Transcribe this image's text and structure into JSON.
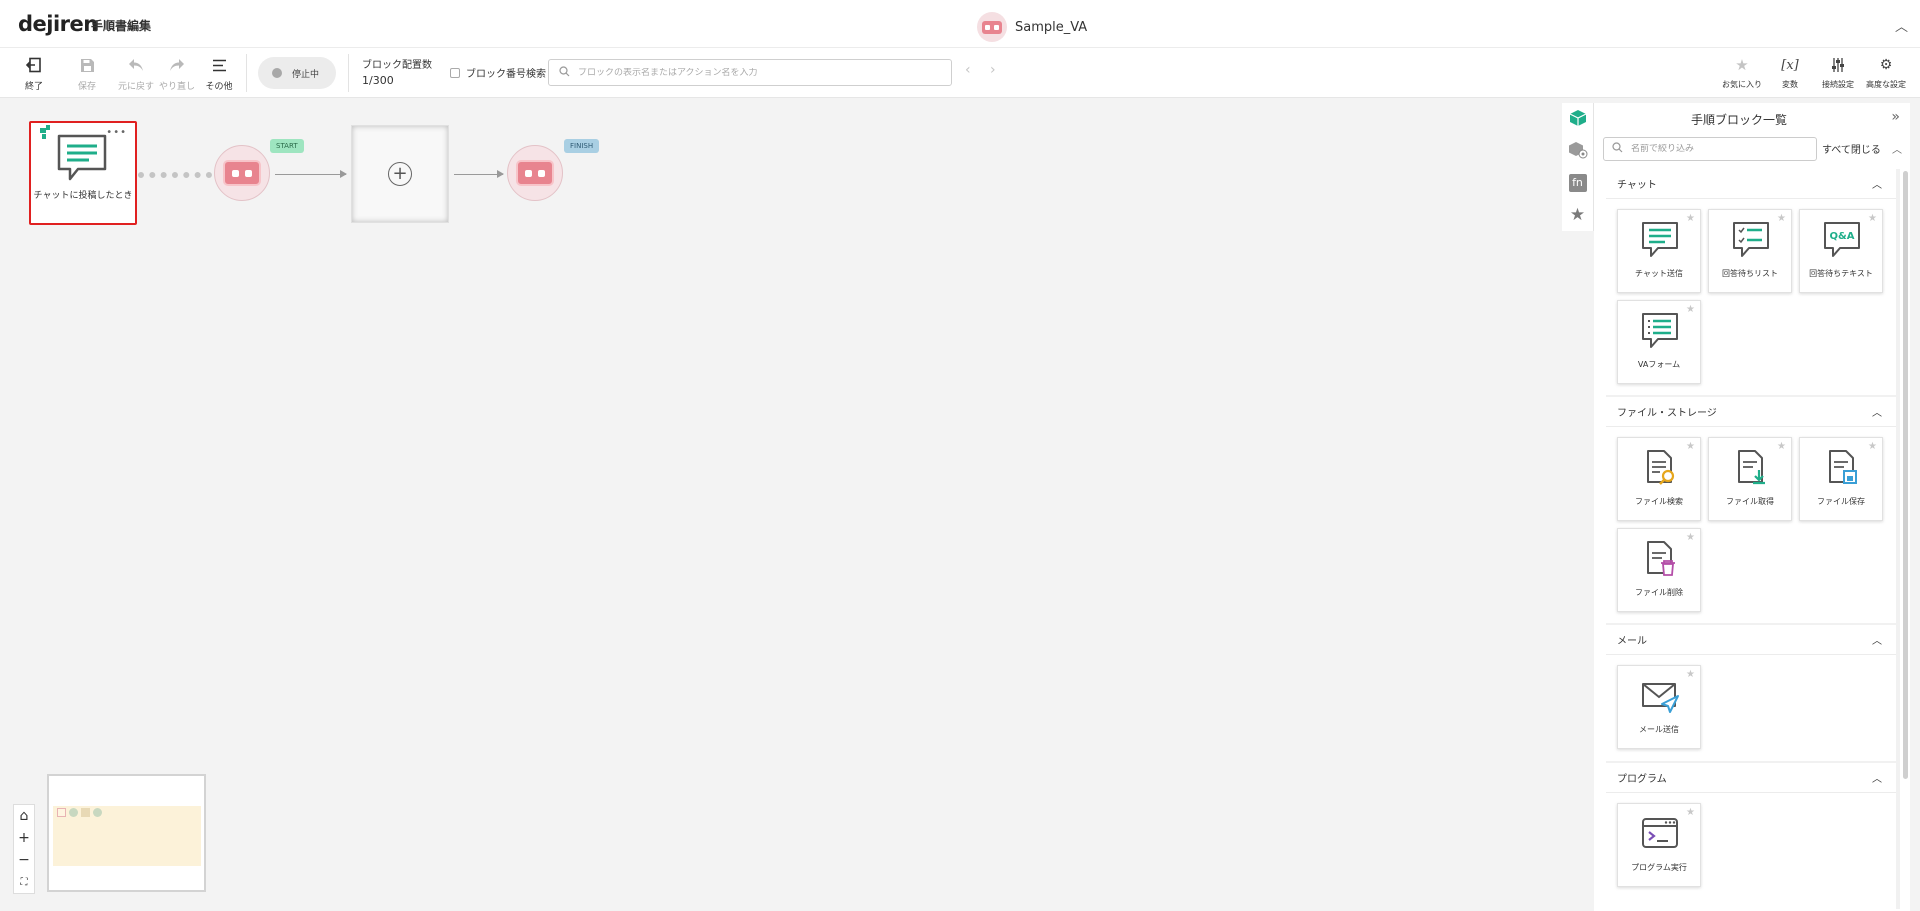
{
  "header": {
    "logo": "dejiren",
    "page_title": "手順書編集",
    "va_name": "Sample_VA"
  },
  "toolbar": {
    "exit_label": "終了",
    "save_label": "保存",
    "undo_label": "元に戻す",
    "redo_label": "やり直し",
    "other_label": "その他",
    "status_label": "停止中",
    "block_count_label": "ブロック配置数",
    "block_count_value": "1/300",
    "block_number_search_label": "ブロック番号検索",
    "search_placeholder": "ブロックの表示名またはアクション名を入力",
    "favorites_label": "お気に入り",
    "variables_label": "変数",
    "connection_settings_label": "接続設定",
    "advanced_settings_label": "高度な設定"
  },
  "canvas": {
    "trigger_label": "チャットに投稿したとき",
    "start_tag": "START",
    "finish_tag": "FINISH"
  },
  "panel": {
    "title": "手順ブロック一覧",
    "filter_placeholder": "名前で絞り込み",
    "collapse_all": "すべて閉じる",
    "sections": [
      {
        "name": "チャット",
        "items": [
          "チャット送信",
          "回答待ちリスト",
          "回答待ちテキスト",
          "VAフォーム"
        ]
      },
      {
        "name": "ファイル・ストレージ",
        "items": [
          "ファイル検索",
          "ファイル取得",
          "ファイル保存",
          "ファイル削除"
        ]
      },
      {
        "name": "メール",
        "items": [
          "メール送信"
        ]
      },
      {
        "name": "プログラム",
        "items": [
          "プログラム実行"
        ]
      }
    ]
  },
  "colors": {
    "accent_green": "#1fae8a",
    "selected_border": "#e02020",
    "va_pink": "#e8848f"
  }
}
